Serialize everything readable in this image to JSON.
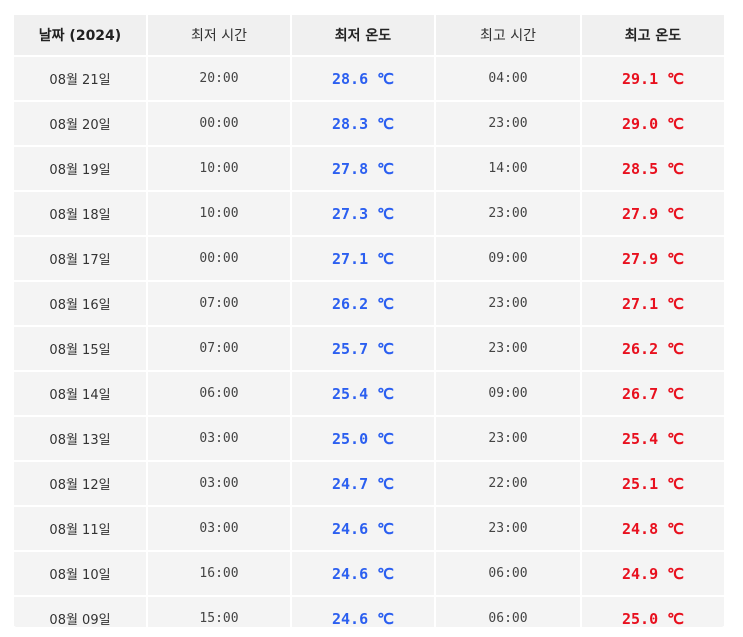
{
  "header": {
    "date": "날짜 (2024)",
    "min_time": "최저 시간",
    "min_temp": "최저 온도",
    "max_time": "최고 시간",
    "max_temp": "최고 온도"
  },
  "colors": {
    "low": "#2b5ff0",
    "high": "#e8101e"
  },
  "rows": [
    {
      "date": "08월 21일",
      "min_time": "20:00",
      "min_temp": "28.6 ℃",
      "max_time": "04:00",
      "max_temp": "29.1 ℃"
    },
    {
      "date": "08월 20일",
      "min_time": "00:00",
      "min_temp": "28.3 ℃",
      "max_time": "23:00",
      "max_temp": "29.0 ℃"
    },
    {
      "date": "08월 19일",
      "min_time": "10:00",
      "min_temp": "27.8 ℃",
      "max_time": "14:00",
      "max_temp": "28.5 ℃"
    },
    {
      "date": "08월 18일",
      "min_time": "10:00",
      "min_temp": "27.3 ℃",
      "max_time": "23:00",
      "max_temp": "27.9 ℃"
    },
    {
      "date": "08월 17일",
      "min_time": "00:00",
      "min_temp": "27.1 ℃",
      "max_time": "09:00",
      "max_temp": "27.9 ℃"
    },
    {
      "date": "08월 16일",
      "min_time": "07:00",
      "min_temp": "26.2 ℃",
      "max_time": "23:00",
      "max_temp": "27.1 ℃"
    },
    {
      "date": "08월 15일",
      "min_time": "07:00",
      "min_temp": "25.7 ℃",
      "max_time": "23:00",
      "max_temp": "26.2 ℃"
    },
    {
      "date": "08월 14일",
      "min_time": "06:00",
      "min_temp": "25.4 ℃",
      "max_time": "09:00",
      "max_temp": "26.7 ℃"
    },
    {
      "date": "08월 13일",
      "min_time": "03:00",
      "min_temp": "25.0 ℃",
      "max_time": "23:00",
      "max_temp": "25.4 ℃"
    },
    {
      "date": "08월 12일",
      "min_time": "03:00",
      "min_temp": "24.7 ℃",
      "max_time": "22:00",
      "max_temp": "25.1 ℃"
    },
    {
      "date": "08월 11일",
      "min_time": "03:00",
      "min_temp": "24.6 ℃",
      "max_time": "23:00",
      "max_temp": "24.8 ℃"
    },
    {
      "date": "08월 10일",
      "min_time": "16:00",
      "min_temp": "24.6 ℃",
      "max_time": "06:00",
      "max_temp": "24.9 ℃"
    },
    {
      "date": "08월 09일",
      "min_time": "15:00",
      "min_temp": "24.6 ℃",
      "max_time": "06:00",
      "max_temp": "25.0 ℃"
    }
  ]
}
